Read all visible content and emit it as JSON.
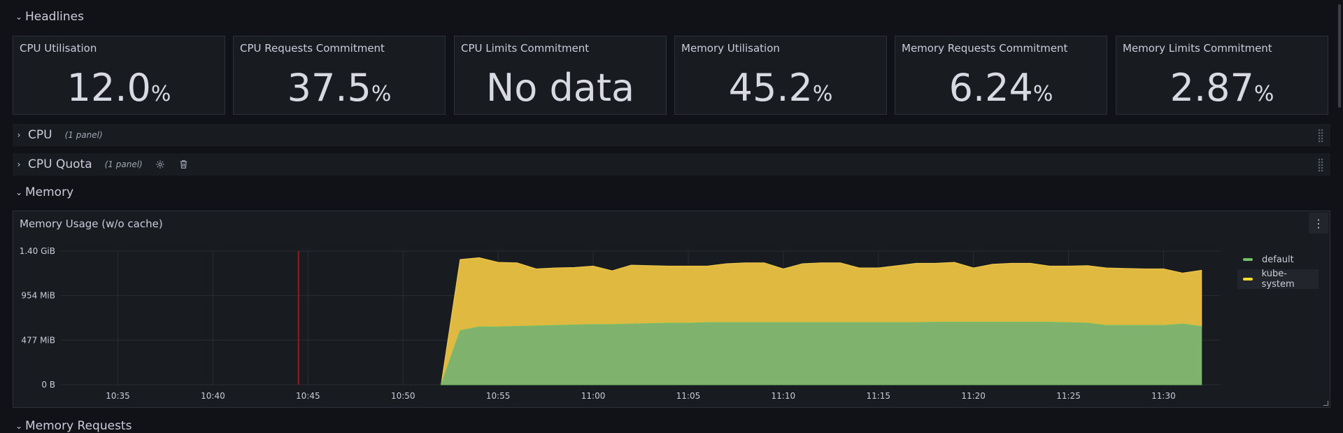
{
  "rows": {
    "headlines": "Headlines",
    "cpu": {
      "title": "CPU",
      "count": "(1 panel)"
    },
    "cpu_quota": {
      "title": "CPU Quota",
      "count": "(1 panel)"
    },
    "memory": "Memory",
    "memory_requests": "Memory Requests"
  },
  "stats": [
    {
      "title": "CPU Utilisation",
      "value": "12.0",
      "unit": "%"
    },
    {
      "title": "CPU Requests Commitment",
      "value": "37.5",
      "unit": "%"
    },
    {
      "title": "CPU Limits Commitment",
      "value": "No data",
      "unit": ""
    },
    {
      "title": "Memory Utilisation",
      "value": "45.2",
      "unit": "%"
    },
    {
      "title": "Memory Requests Commitment",
      "value": "6.24",
      "unit": "%"
    },
    {
      "title": "Memory Limits Commitment",
      "value": "2.87",
      "unit": "%"
    }
  ],
  "panel": {
    "title": "Memory Usage (w/o cache)"
  },
  "colors": {
    "default": "#73bf69",
    "kube_system": "#fade2a",
    "annotation": "#8f1e1e",
    "background": "#111217",
    "panel": "#181b1f"
  },
  "chart_data": {
    "type": "area",
    "stacked": true,
    "y_ticks": [
      "0 B",
      "477 MiB",
      "954 MiB",
      "1.40 GiB"
    ],
    "x_ticks": [
      "10:35",
      "10:40",
      "10:45",
      "10:50",
      "10:55",
      "11:00",
      "11:05",
      "11:10",
      "11:15",
      "11:20",
      "11:25",
      "11:30"
    ],
    "ylim_mib": [
      0,
      1430
    ],
    "xlim": [
      "10:32",
      "11:33"
    ],
    "annotation_time": "10:44.5",
    "legend_position": "right",
    "x": [
      "10:52",
      "10:53",
      "10:54",
      "10:55",
      "10:56",
      "10:57",
      "10:58",
      "10:59",
      "11:00",
      "11:01",
      "11:02",
      "11:03",
      "11:04",
      "11:05",
      "11:06",
      "11:07",
      "11:08",
      "11:09",
      "11:10",
      "11:11",
      "11:12",
      "11:13",
      "11:14",
      "11:15",
      "11:16",
      "11:17",
      "11:18",
      "11:19",
      "11:20",
      "11:21",
      "11:22",
      "11:23",
      "11:24",
      "11:25",
      "11:26",
      "11:27",
      "11:28",
      "11:29",
      "11:30",
      "11:31",
      "11:32"
    ],
    "series": [
      {
        "name": "default",
        "values": [
          0,
          580,
          620,
          620,
          625,
          630,
          635,
          640,
          645,
          645,
          650,
          655,
          660,
          660,
          665,
          665,
          665,
          665,
          665,
          665,
          665,
          665,
          665,
          665,
          665,
          665,
          670,
          670,
          670,
          670,
          670,
          670,
          670,
          665,
          660,
          635,
          635,
          635,
          635,
          650,
          625
        ]
      },
      {
        "name": "kube-system",
        "values": [
          0,
          760,
          740,
          690,
          680,
          610,
          615,
          615,
          625,
          575,
          630,
          620,
          610,
          610,
          605,
          630,
          640,
          640,
          575,
          630,
          640,
          640,
          585,
          585,
          610,
          635,
          630,
          640,
          580,
          620,
          630,
          630,
          600,
          605,
          615,
          615,
          610,
          605,
          605,
          545,
          600
        ]
      }
    ]
  }
}
